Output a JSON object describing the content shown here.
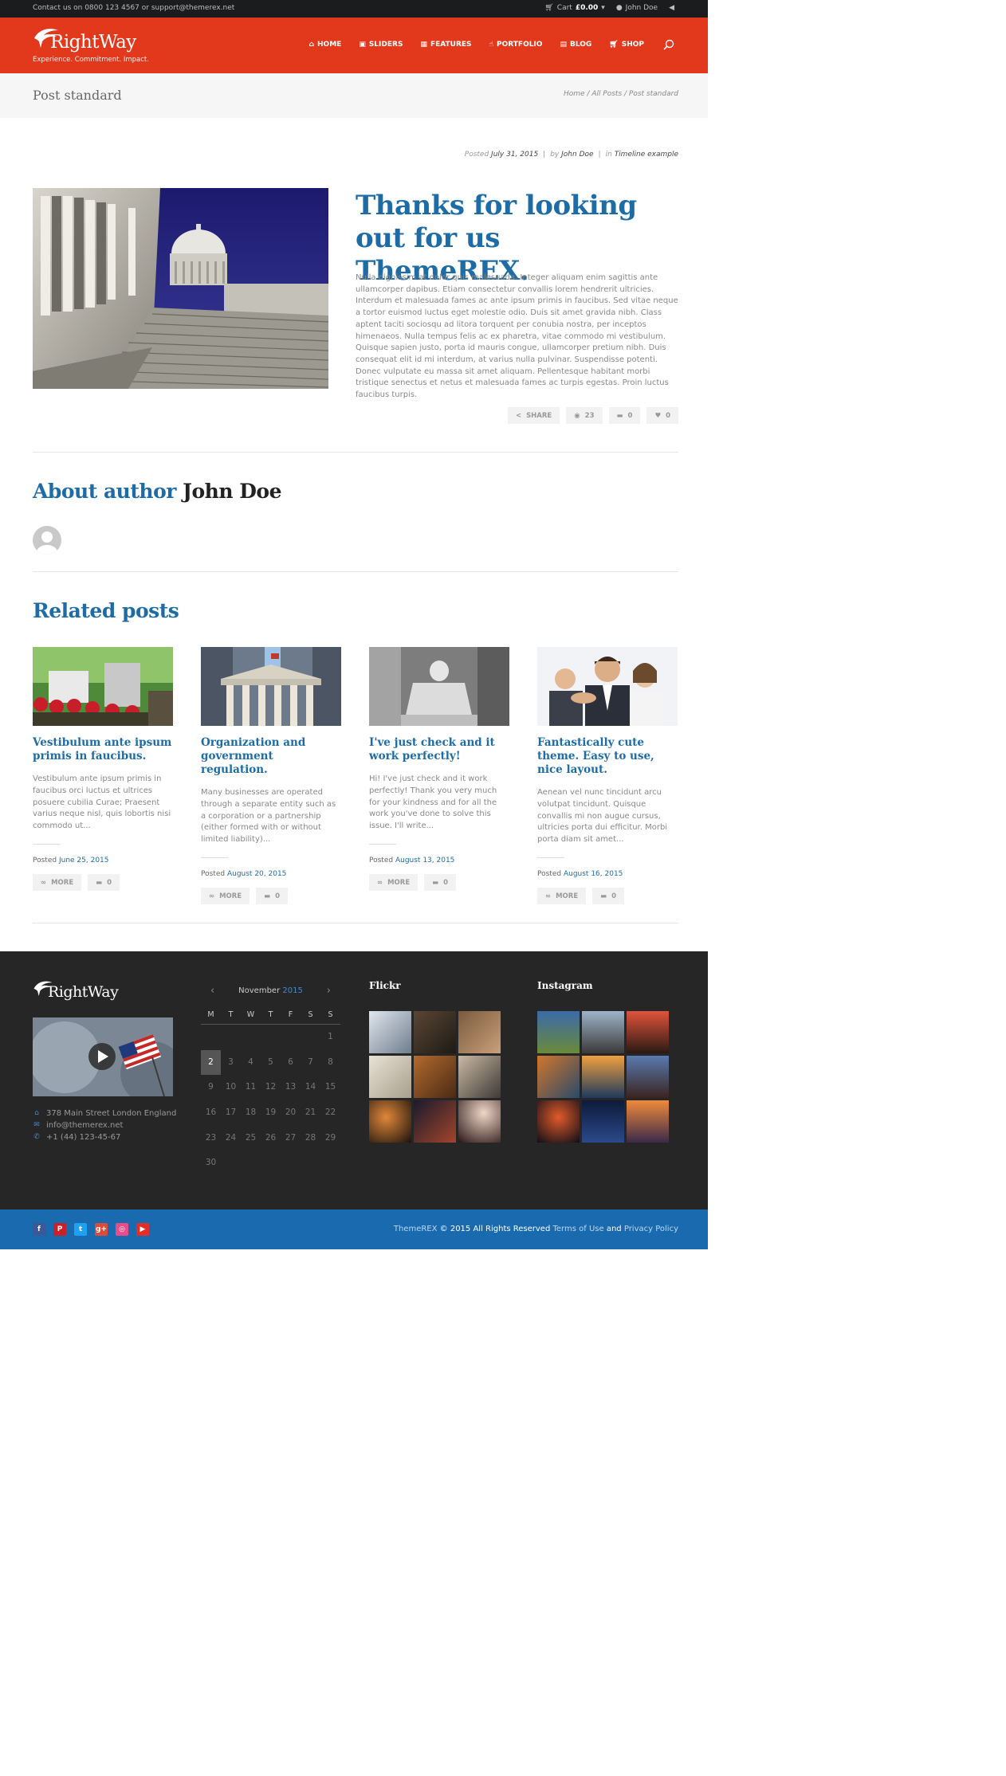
{
  "topbar": {
    "contact": "Contact us on 0800 123 4567 or support@themerex.net",
    "cart_label": "Cart",
    "cart_value": "£0.00",
    "user": "John Doe"
  },
  "header": {
    "logo_name": "RightWay",
    "logo_tagline": "Experience. Commitment. Impact.",
    "nav": [
      "HOME",
      "SLIDERS",
      "FEATURES",
      "PORTFOLIO",
      "BLOG",
      "SHOP"
    ]
  },
  "titlebar": {
    "title": "Post standard",
    "breadcrumb": [
      "Home",
      "All Posts",
      "Post standard"
    ]
  },
  "post": {
    "meta_posted": "Posted",
    "date": "July 31, 2015",
    "meta_by": "by",
    "author": "John Doe",
    "meta_in": "in",
    "category": "Timeline example",
    "heading": "Thanks for looking out for us ThemeREX.",
    "body": "Nulla dignissim at dolor quis malesuada. Integer aliquam enim sagittis ante ullamcorper dapibus. Etiam consectetur convallis lorem hendrerit ultricies. Interdum et malesuada fames ac ante ipsum primis in faucibus. Sed vitae neque a tortor euismod luctus eget molestie odio. Duis sit amet gravida nibh. Class aptent taciti sociosqu ad litora torquent per conubia nostra, per inceptos himenaeos. Nulla tempus felis ac ex pharetra, vitae commodo mi vestibulum. Quisque sapien justo, porta id mauris congue, ullamcorper pretium nibh. Duis consequat elit id mi interdum, at varius nulla pulvinar. Suspendisse potenti. Donec vulputate eu massa sit amet aliquam. Pellentesque habitant morbi tristique senectus et netus et malesuada fames ac turpis egestas. Proin luctus faucibus turpis.",
    "share_label": "SHARE",
    "views": "23",
    "comments": "0",
    "likes": "0"
  },
  "author_box": {
    "label": "About author",
    "name": "John Doe"
  },
  "related": {
    "title": "Related posts",
    "posted_label": "Posted",
    "more_label": "MORE",
    "items": [
      {
        "title": "Vestibulum ante ipsum primis in faucibus.",
        "excerpt": "Vestibulum ante ipsum primis in faucibus orci luctus et ultrices posuere cubilia Curae; Praesent varius neque nisl, quis lobortis nisi commodo ut...",
        "date": "June 25, 2015",
        "comments": "0"
      },
      {
        "title": "Organization and government regulation.",
        "excerpt": "Many businesses are operated through a separate entity such as a corporation or a partnership (either formed with or without limited liability)...",
        "date": "August 20, 2015",
        "comments": "0"
      },
      {
        "title": "I've just check and it work perfectly!",
        "excerpt": "Hi! I've just check and it work perfectly! Thank you very much for your kindness and for all the work you've done to solve this issue. I'll write...",
        "date": "August 13, 2015",
        "comments": "0"
      },
      {
        "title": "Fantastically cute theme. Easy to use, nice layout.",
        "excerpt": "Aenean vel nunc tincidunt arcu volutpat tincidunt. Quisque convallis mi non augue cursus, ultricies porta dui efficitur. Morbi porta diam sit amet...",
        "date": "August 16, 2015",
        "comments": "0"
      }
    ]
  },
  "footer": {
    "logo_name": "RightWay",
    "address": "378 Main Street London England",
    "email": "info@themerex.net",
    "phone": "+1 (44) 123-45-67",
    "calendar": {
      "month": "November",
      "year": "2015",
      "weekdays": [
        "M",
        "T",
        "W",
        "T",
        "F",
        "S",
        "S"
      ],
      "today": "2",
      "days": [
        "",
        "",
        "",
        "",
        "",
        "",
        "1",
        "2",
        "3",
        "4",
        "5",
        "6",
        "7",
        "8",
        "9",
        "10",
        "11",
        "12",
        "13",
        "14",
        "15",
        "16",
        "17",
        "18",
        "19",
        "20",
        "21",
        "22",
        "23",
        "24",
        "25",
        "26",
        "27",
        "28",
        "29",
        "30"
      ]
    },
    "flickr_title": "Flickr",
    "instagram_title": "Instagram"
  },
  "bottom": {
    "brand": "ThemeREX",
    "copyright": "© 2015 All Rights Reserved",
    "terms": "Terms of Use",
    "and": "and",
    "privacy": "Privacy Policy"
  },
  "colors": {
    "accent_red": "#e2391d",
    "link_blue": "#1e6ca5",
    "footer_dark": "#262626",
    "bottom_blue": "#1a6ab0"
  }
}
